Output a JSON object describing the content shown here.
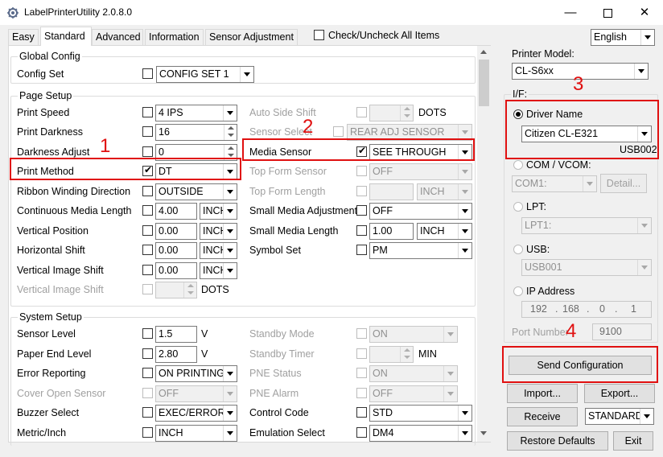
{
  "window": {
    "title": "LabelPrinterUtility 2.0.8.0"
  },
  "tabs": [
    "Easy",
    "Standard",
    "Advanced",
    "Information",
    "Sensor Adjustment"
  ],
  "check_all": "Check/Uncheck All Items",
  "language": "English",
  "global": {
    "title": "Global Config",
    "config_set_label": "Config Set",
    "config_set_value": "CONFIG SET 1"
  },
  "page_setup": {
    "title": "Page Setup",
    "print_speed": {
      "label": "Print Speed",
      "value": "4 IPS"
    },
    "print_darkness": {
      "label": "Print Darkness",
      "value": "16"
    },
    "darkness_adjust": {
      "label": "Darkness Adjust",
      "value": "0"
    },
    "print_method": {
      "label": "Print Method",
      "value": "DT"
    },
    "ribbon_winding": {
      "label": "Ribbon Winding Direction",
      "value": "OUTSIDE"
    },
    "continuous_len": {
      "label": "Continuous Media Length",
      "value": "4.00",
      "unit": "INCH"
    },
    "vertical_pos": {
      "label": "Vertical Position",
      "value": "0.00",
      "unit": "INCH"
    },
    "horizontal_shift": {
      "label": "Horizontal Shift",
      "value": "0.00",
      "unit": "INCH"
    },
    "vertical_image_shift": {
      "label": "Vertical Image Shift",
      "value": "0.00",
      "unit": "INCH"
    },
    "vertical_image_shift2": {
      "label": "Vertical Image Shift",
      "unit": "DOTS"
    },
    "auto_side_shift": {
      "label": "Auto Side Shift",
      "unit": "DOTS"
    },
    "sensor_select": {
      "label": "Sensor Select",
      "value": "REAR ADJ SENSOR"
    },
    "media_sensor": {
      "label": "Media Sensor",
      "value": "SEE THROUGH"
    },
    "top_form_sensor": {
      "label": "Top Form Sensor",
      "value": "OFF"
    },
    "top_form_length": {
      "label": "Top Form Length",
      "unit": "INCH"
    },
    "small_media_adj": {
      "label": "Small Media Adjustment",
      "value": "OFF"
    },
    "small_media_len": {
      "label": "Small Media Length",
      "value": "1.00",
      "unit": "INCH"
    },
    "symbol_set": {
      "label": "Symbol Set",
      "value": "PM"
    }
  },
  "system_setup": {
    "title": "System Setup",
    "sensor_level": {
      "label": "Sensor Level",
      "value": "1.5",
      "unit": "V"
    },
    "paper_end_level": {
      "label": "Paper End Level",
      "value": "2.80",
      "unit": "V"
    },
    "error_reporting": {
      "label": "Error Reporting",
      "value": "ON PRINTING"
    },
    "cover_open_sensor": {
      "label": "Cover Open Sensor",
      "value": "OFF"
    },
    "buzzer_select": {
      "label": "Buzzer Select",
      "value": "EXEC/ERROR"
    },
    "metric_inch": {
      "label": "Metric/Inch",
      "value": "INCH"
    },
    "standby_mode": {
      "label": "Standby Mode",
      "value": "ON"
    },
    "standby_timer": {
      "label": "Standby Timer",
      "unit": "MIN"
    },
    "pne_status": {
      "label": "PNE Status",
      "value": "ON"
    },
    "pne_alarm": {
      "label": "PNE Alarm",
      "value": "OFF"
    },
    "control_code": {
      "label": "Control Code",
      "value": "STD"
    },
    "emulation_select": {
      "label": "Emulation Select",
      "value": "DM4"
    }
  },
  "right": {
    "printer_model_label": "Printer Model:",
    "printer_model": "CL-S6xx",
    "if_label": "I/F:",
    "driver_name_label": "Driver Name",
    "driver_name": "Citizen CL-E321",
    "driver_port": "USB002",
    "com_label": "COM / VCOM:",
    "com_value": "COM1:",
    "detail": "Detail...",
    "lpt_label": "LPT:",
    "lpt_value": "LPT1:",
    "usb_label": "USB:",
    "usb_value": "USB001",
    "ip_label": "IP Address",
    "ip": [
      "192",
      "168",
      "0",
      "1"
    ],
    "port_label": "Port Number",
    "port_value": "9100",
    "send": "Send Configuration",
    "import": "Import...",
    "export": "Export...",
    "receive": "Receive",
    "standard": "STANDARD",
    "restore": "Restore Defaults",
    "exit": "Exit"
  },
  "annotations": [
    "1",
    "2",
    "3",
    "4"
  ]
}
